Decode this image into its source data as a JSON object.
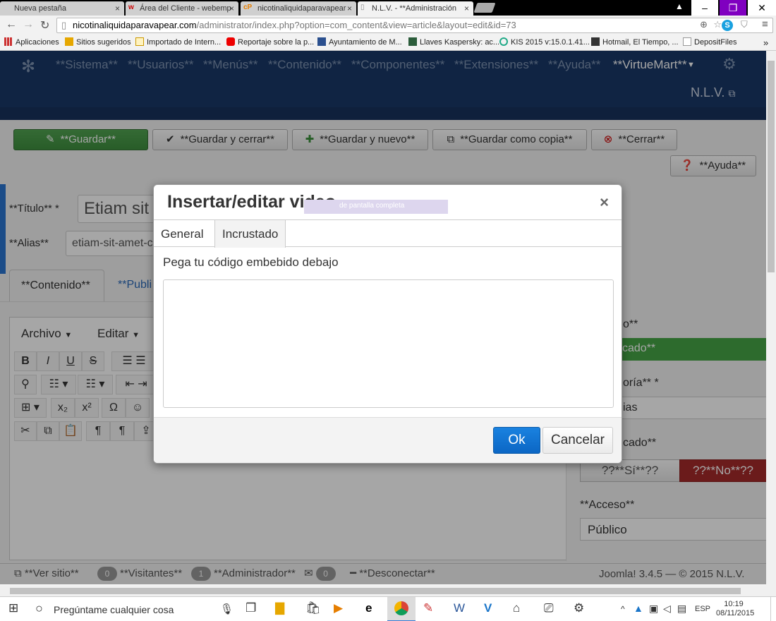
{
  "browser": {
    "tabs": [
      {
        "label": "Nueva pestaña"
      },
      {
        "label": "Área del Cliente - webemp"
      },
      {
        "label": "nicotinaliquidaparavapear"
      },
      {
        "label": "N.L.V. - **Administración"
      }
    ],
    "url_host": "nicotinaliquidaparavapear.com",
    "url_path": "/administrator/index.php?option=com_content&view=article&layout=edit&id=73",
    "bookmarks": [
      "Aplicaciones",
      "Sitios sugeridos",
      "Importado de Intern...",
      "Reportaje sobre la p...",
      "Ayuntamiento de M...",
      "Llaves Kaspersky: ac...",
      "KIS 2015 v:15.0.1.41...",
      "Hotmail, El Tiempo, ...",
      "DepositFiles"
    ]
  },
  "joomla": {
    "menu": [
      "**Sistema**",
      "**Usuarios**",
      "**Menús**",
      "**Contenido**",
      "**Componentes**",
      "**Extensiones**",
      "**Ayuda**",
      "**VirtueMart**"
    ],
    "site_link": "N.L.V.",
    "toolbar": {
      "save": "**Guardar**",
      "save_close": "**Guardar y cerrar**",
      "save_new": "**Guardar y nuevo**",
      "save_copy": "**Guardar como copia**",
      "close": "**Cerrar**",
      "help": "**Ayuda**"
    },
    "form": {
      "title_label": "**Título** *",
      "title_value": "Etiam sit a",
      "alias_label": "**Alias**",
      "alias_value": "etiam-sit-amet-c",
      "tab_content": "**Contenido**",
      "tab_publishing": "**Publi",
      "editor_menu_file": "Archivo",
      "editor_menu_edit": "Editar"
    },
    "sidebar": {
      "state_label_partial": "o**",
      "state_value_partial": "cado**",
      "category_label_partial": "oría** *",
      "category_value_partial": "ias",
      "featured_label_partial": "cado**",
      "yes": "??**Sí**??",
      "no": "??**No**??",
      "access_label": "**Acceso**",
      "access_value": "Público"
    },
    "status": {
      "view_site": "**Ver sitio**",
      "visitors_count": "0",
      "visitors": "**Visitantes**",
      "admin_count": "1",
      "admin": "**Administrador**",
      "messages_count": "0",
      "logout": "**Desconectar**",
      "version": "Joomla! 3.4.5 — © 2015 N.L.V."
    }
  },
  "modal": {
    "title": "Insertar/editar video",
    "fullscreen_hint": "de pantalla completa",
    "tabs": [
      "General",
      "Incrustado"
    ],
    "active_tab": "Incrustado",
    "embed_label": "Pega tu código embebido debajo",
    "ok": "Ok",
    "cancel": "Cancelar"
  },
  "taskbar": {
    "search_placeholder": "Pregúntame cualquier cosa",
    "lang": "ESP",
    "time": "10:19",
    "date": "08/11/2015"
  },
  "colors": {
    "joomla_nav": "#1a3867",
    "save_green": "#46a546",
    "ok_blue": "#1073d3",
    "no_red": "#a52a2a"
  }
}
